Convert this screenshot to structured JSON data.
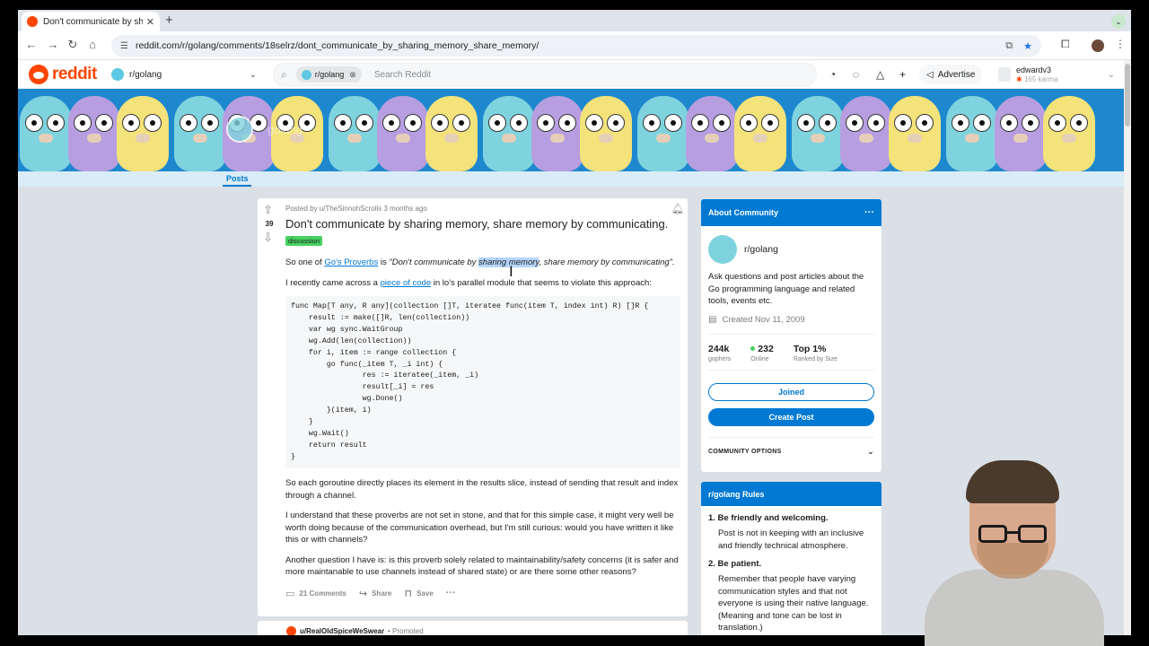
{
  "browser": {
    "tab_title": "Don't communicate by sharin",
    "url": "reddit.com/r/golang/comments/18selrz/dont_communicate_by_sharing_memory_share_memory/"
  },
  "header": {
    "logo_text": "reddit",
    "community": "r/golang",
    "search_chip": "r/golang",
    "search_placeholder": "Search Reddit",
    "advertise_label": "Advertise",
    "username": "edwardv3",
    "karma": "165 karma"
  },
  "banner": {
    "title": "golang",
    "tab_posts": "Posts"
  },
  "post": {
    "score": "39",
    "meta": "Posted by u/TheSinnohScrolls 3 months ago",
    "title": "Don't communicate by sharing memory, share memory by communicating.",
    "flair": "discussion",
    "p1_a": "So one of ",
    "p1_link": "Go's Proverbs",
    "p1_b": " is ",
    "p1_q1": "\"Don't communicate by ",
    "p1_hl": "sharing memory",
    "p1_q2": ", share memory by communicating\".",
    "p2_a": "I recently came across a ",
    "p2_link": "piece of code",
    "p2_b": " in lo's parallel module that seems to violate this approach:",
    "code": "func Map[T any, R any](collection []T, iteratee func(item T, index int) R) []R {\n    result := make([]R, len(collection))\n    var wg sync.WaitGroup\n    wg.Add(len(collection))\n    for i, item := range collection {\n        go func(_item T, _i int) {\n                res := iteratee(_item, _i)\n                result[_i] = res\n                wg.Done()\n        }(item, i)\n    }\n    wg.Wait()\n    return result\n}",
    "p3": "So each goroutine directly places its element in the results slice, instead of sending that result and index through a channel.",
    "p4": "I understand that these proverbs are not set in stone, and that for this simple case, it might very well be worth doing because of the communication overhead, but I'm still curious: would you have written it like this or with channels?",
    "p5": "Another question I have is: is this proverb solely related to maintainability/safety concerns (it is safer and more maintanable to use channels instead of shared state) or are there some other reasons?",
    "comments": "21 Comments",
    "share": "Share",
    "save": "Save"
  },
  "promoted": {
    "user": "u/RealOldSpiceWeSwear",
    "label": "• Promoted"
  },
  "about": {
    "heading": "About Community",
    "name": "r/golang",
    "description": "Ask questions and post articles about the Go programming language and related tools, events etc.",
    "created": "Created Nov 11, 2009",
    "members_value": "244k",
    "members_label": "gophers",
    "online_value": "232",
    "online_label": "Online",
    "rank_value": "Top 1%",
    "rank_label": "Ranked by Size",
    "joined_label": "Joined",
    "create_post_label": "Create Post",
    "options_label": "COMMUNITY OPTIONS"
  },
  "rules": {
    "heading": "r/golang Rules",
    "items": [
      {
        "title": "1. Be friendly and welcoming.",
        "desc": "Post is not in keeping with an inclusive and friendly technical atmosphere."
      },
      {
        "title": "2. Be patient.",
        "desc": "Remember that people have varying communication styles and that not everyone is using their native language. (Meaning and tone can be lost in translation.)"
      }
    ]
  },
  "colors": {
    "brand": "#ff4500",
    "accent": "#0079d3",
    "flair": "#46d160",
    "banner": "#1e88cf"
  }
}
